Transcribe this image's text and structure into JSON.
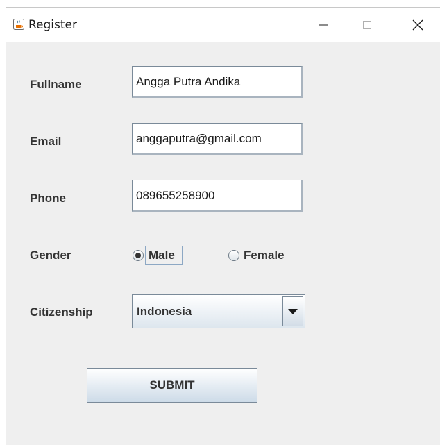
{
  "window": {
    "title": "Register",
    "icon": "java-coffee-icon",
    "controls": [
      "minimize-icon",
      "maximize-icon",
      "close-icon"
    ]
  },
  "form": {
    "fullname": {
      "label": "Fullname",
      "value": "Angga Putra Andika"
    },
    "email": {
      "label": "Email",
      "value": "anggaputra@gmail.com"
    },
    "phone": {
      "label": "Phone",
      "value": "089655258900"
    },
    "gender": {
      "label": "Gender",
      "options": [
        {
          "label": "Male",
          "selected": true
        },
        {
          "label": "Female",
          "selected": false
        }
      ]
    },
    "citizenship": {
      "label": "Citizenship",
      "selected": "Indonesia"
    },
    "submit_label": "SUBMIT"
  },
  "colors": {
    "window_bg": "#efefef",
    "titlebar_bg": "#ffffff",
    "text": "#333333",
    "field_border": "#7a8a99"
  }
}
